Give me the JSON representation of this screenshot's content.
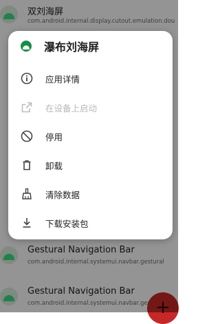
{
  "background_list": {
    "items": [
      {
        "title": "双刘海屏",
        "subtitle": "com.android.internal.display.cutout.emulation.double"
      },
      {
        "title": "Gestural Navigation Bar",
        "subtitle": "com.android.internal.systemui.navbar.gestural"
      },
      {
        "title": "Gestural Navigation Bar",
        "subtitle": "com.android.internal.systemui.navbar.gestural"
      }
    ],
    "fab_label": "+"
  },
  "dialog": {
    "title": "瀑布刘海屏",
    "menu": [
      {
        "label": "应用详情",
        "icon": "info-icon",
        "enabled": true
      },
      {
        "label": "在设备上启动",
        "icon": "open-in-new-icon",
        "enabled": false
      },
      {
        "label": "停用",
        "icon": "block-icon",
        "enabled": true
      },
      {
        "label": "卸载",
        "icon": "trash-icon",
        "enabled": true
      },
      {
        "label": "清除数据",
        "icon": "cleaning-icon",
        "enabled": true
      },
      {
        "label": "下载安装包",
        "icon": "download-icon",
        "enabled": true
      }
    ]
  },
  "colors": {
    "fab": "#c62828",
    "app_icon_green": "#3ddc84",
    "disabled_text": "#b8b8b8"
  }
}
